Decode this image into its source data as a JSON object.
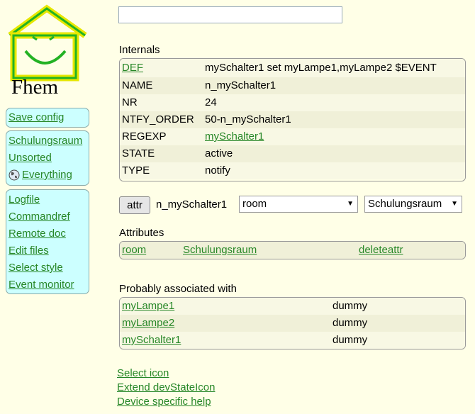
{
  "logo": {
    "text": "Fhem"
  },
  "command_input": {
    "value": "",
    "placeholder": ""
  },
  "menu": {
    "group1": [
      {
        "label": "Save config"
      }
    ],
    "group2": [
      {
        "label": "Schulungsraum"
      },
      {
        "label": "Unsorted"
      },
      {
        "label": "Everything",
        "icon": "globe-icon"
      }
    ],
    "group3": [
      {
        "label": "Logfile"
      },
      {
        "label": "Commandref"
      },
      {
        "label": "Remote doc"
      },
      {
        "label": "Edit files"
      },
      {
        "label": "Select style"
      },
      {
        "label": "Event monitor"
      }
    ]
  },
  "internals": {
    "title": "Internals",
    "rows": [
      {
        "key": "DEF",
        "value": "mySchalter1 set myLampe1,myLampe2 $EVENT",
        "key_is_link": true,
        "value_is_link": false
      },
      {
        "key": "NAME",
        "value": "n_mySchalter1",
        "key_is_link": false,
        "value_is_link": false
      },
      {
        "key": "NR",
        "value": "24",
        "key_is_link": false,
        "value_is_link": false
      },
      {
        "key": "NTFY_ORDER",
        "value": "50-n_mySchalter1",
        "key_is_link": false,
        "value_is_link": false
      },
      {
        "key": "REGEXP",
        "value": "mySchalter1",
        "key_is_link": false,
        "value_is_link": true
      },
      {
        "key": "STATE",
        "value": "active",
        "key_is_link": false,
        "value_is_link": false
      },
      {
        "key": "TYPE",
        "value": "notify",
        "key_is_link": false,
        "value_is_link": false
      }
    ]
  },
  "attr_line": {
    "button_label": "attr",
    "device": "n_mySchalter1",
    "attribute_selected": "room",
    "value_selected": "Schulungsraum"
  },
  "attributes": {
    "title": "Attributes",
    "rows": [
      {
        "name": "room",
        "value": "Schulungsraum",
        "action": "deleteattr"
      }
    ]
  },
  "associated": {
    "title": "Probably associated with",
    "rows": [
      {
        "name": "myLampe1",
        "type": "dummy"
      },
      {
        "name": "myLampe2",
        "type": "dummy"
      },
      {
        "name": "mySchalter1",
        "type": "dummy"
      }
    ]
  },
  "bottom_links": [
    {
      "label": "Select icon"
    },
    {
      "label": "Extend devStateIcon"
    },
    {
      "label": "Device specific help"
    }
  ],
  "colors": {
    "link": "#278727",
    "background": "#ffffe7",
    "menu_bg": "#ccffff",
    "logo_green": "#23b223",
    "logo_yellow": "#e7e700"
  }
}
